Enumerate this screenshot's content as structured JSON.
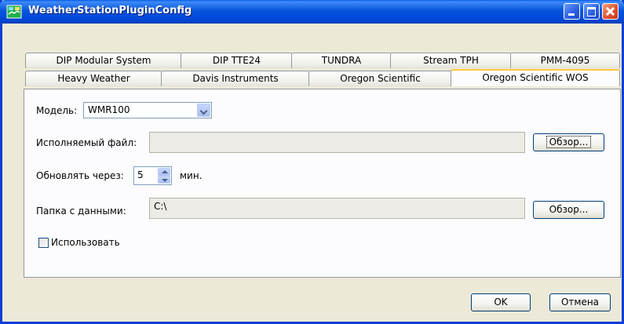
{
  "window": {
    "title": "WeatherStationPluginConfig",
    "colors": {
      "titlebar": "#0855dd",
      "frame": "#0a3fd6",
      "dialog_bg": "#ece9d8",
      "active_tab_accent": "#ffc83c",
      "close_button": "#e0502a"
    }
  },
  "tabs": {
    "row1": [
      {
        "label": "DIP Modular System"
      },
      {
        "label": "DIP TTE24"
      },
      {
        "label": "TUNDRA"
      },
      {
        "label": "Stream TPH"
      },
      {
        "label": "PMM-4095"
      }
    ],
    "row2": [
      {
        "label": "Heavy Weather"
      },
      {
        "label": "Davis Instruments"
      },
      {
        "label": "Oregon Scientific"
      },
      {
        "label": "Oregon Scientific WOS",
        "active": true
      }
    ]
  },
  "form": {
    "model_label": "Модель:",
    "model_value": "WMR100",
    "exe_label": "Исполняемый файл:",
    "exe_value": "",
    "browse_label": "Обзор...",
    "update_label": "Обновлять через:",
    "update_value": "5",
    "update_unit": "мин.",
    "folder_label": "Папка с данными:",
    "folder_value": "C:\\",
    "browse2_label": "Обзор...",
    "use_label": "Использовать",
    "use_checked": false
  },
  "footer": {
    "ok_label": "OK",
    "cancel_label": "Отмена"
  },
  "icons": [
    "app-icon",
    "minimize-icon",
    "maximize-icon",
    "close-icon",
    "chevron-down-icon",
    "spin-up-icon",
    "spin-down-icon"
  ]
}
